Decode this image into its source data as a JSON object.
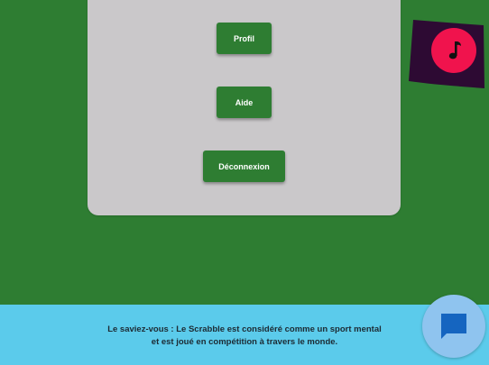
{
  "menu": {
    "profil_label": "Profil",
    "aide_label": "Aide",
    "deconnexion_label": "Déconnexion"
  },
  "music_toggle": {
    "icon": "music-note-icon",
    "flag_color": "#2d0a33",
    "circle_color": "#f0134d"
  },
  "footer": {
    "fun_fact_line1": "Le saviez-vous : Le Scrabble est considéré comme un sport mental",
    "fun_fact_line2": "et est joué en compétition à travers le monde."
  },
  "chat": {
    "icon": "chat-bubble-icon"
  },
  "colors": {
    "background": "#2e7d32",
    "card": "#cac8ca",
    "button": "#2e7d32",
    "footer": "#5bcbeb",
    "chat_fab": "#8fc4ef",
    "chat_icon": "#1565c0"
  }
}
